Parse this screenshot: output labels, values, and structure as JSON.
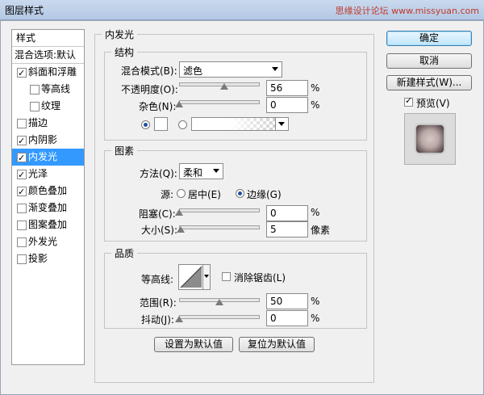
{
  "window": {
    "title": "图层样式",
    "watermark": "思缘设计论坛 www.missyuan.com"
  },
  "style_list": {
    "header": "样式",
    "blend_options": "混合选项:默认",
    "items": [
      {
        "label": "斜面和浮雕",
        "checked": true
      },
      {
        "label": "等高线",
        "checked": false
      },
      {
        "label": "纹理",
        "checked": false
      },
      {
        "label": "描边",
        "checked": false
      },
      {
        "label": "内阴影",
        "checked": true
      },
      {
        "label": "内发光",
        "checked": true,
        "selected": true
      },
      {
        "label": "光泽",
        "checked": true
      },
      {
        "label": "颜色叠加",
        "checked": true
      },
      {
        "label": "渐变叠加",
        "checked": false
      },
      {
        "label": "图案叠加",
        "checked": false
      },
      {
        "label": "外发光",
        "checked": false
      },
      {
        "label": "投影",
        "checked": false
      }
    ]
  },
  "panel": {
    "title": "内发光",
    "structure": {
      "title": "结构",
      "blend_mode_label": "混合模式(B):",
      "blend_mode_value": "滤色",
      "opacity_label": "不透明度(O):",
      "opacity_value": "56",
      "opacity_unit": "%",
      "noise_label": "杂色(N):",
      "noise_value": "0",
      "noise_unit": "%"
    },
    "elements": {
      "title": "图素",
      "method_label": "方法(Q):",
      "method_value": "柔和",
      "source_label": "源:",
      "source_center": "居中(E)",
      "source_edge": "边缘(G)",
      "choke_label": "阻塞(C):",
      "choke_value": "0",
      "choke_unit": "%",
      "size_label": "大小(S):",
      "size_value": "5",
      "size_unit": "像素"
    },
    "quality": {
      "title": "品质",
      "contour_label": "等高线:",
      "antialias_label": "消除锯齿(L)",
      "range_label": "范围(R):",
      "range_value": "50",
      "range_unit": "%",
      "jitter_label": "抖动(J):",
      "jitter_value": "0",
      "jitter_unit": "%"
    },
    "make_default": "设置为默认值",
    "reset_default": "复位为默认值"
  },
  "actions": {
    "ok": "确定",
    "cancel": "取消",
    "new_style": "新建样式(W)...",
    "preview": "预览(V)"
  },
  "levels": {
    "opacity": 0.56,
    "noise": 0.0,
    "choke": 0.0,
    "size": 0.02,
    "range": 0.5,
    "jitter": 0.0
  }
}
